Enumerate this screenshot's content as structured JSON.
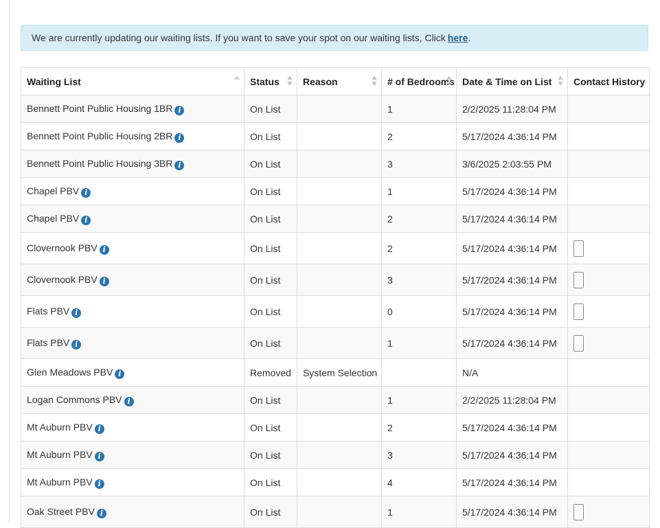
{
  "alert": {
    "message": "We are currently updating our waiting lists. If you want to save your spot on our waiting lists, Click",
    "link_text": "here",
    "trailing": "."
  },
  "table": {
    "headers": [
      "Waiting List",
      "Status",
      "Reason",
      "# of Bedrooms",
      "Date & Time on List",
      "Contact History"
    ],
    "rows": [
      {
        "name": "Bennett Point Public Housing 1BR",
        "status": "On List",
        "reason": "",
        "bedrooms": "1",
        "datetime": "2/2/2025 11:28:04 PM",
        "contact": false
      },
      {
        "name": "Bennett Point Public Housing 2BR",
        "status": "On List",
        "reason": "",
        "bedrooms": "2",
        "datetime": "5/17/2024 4:36:14 PM",
        "contact": false
      },
      {
        "name": "Bennett Point Public Housing 3BR",
        "status": "On List",
        "reason": "",
        "bedrooms": "3",
        "datetime": "3/6/2025 2:03:55 PM",
        "contact": false
      },
      {
        "name": "Chapel PBV",
        "status": "On List",
        "reason": "",
        "bedrooms": "1",
        "datetime": "5/17/2024 4:36:14 PM",
        "contact": false
      },
      {
        "name": "Chapel PBV",
        "status": "On List",
        "reason": "",
        "bedrooms": "2",
        "datetime": "5/17/2024 4:36:14 PM",
        "contact": false
      },
      {
        "name": "Clovernook PBV",
        "status": "On List",
        "reason": "",
        "bedrooms": "2",
        "datetime": "5/17/2024 4:36:14 PM",
        "contact": true
      },
      {
        "name": "Clovernook PBV",
        "status": "On List",
        "reason": "",
        "bedrooms": "3",
        "datetime": "5/17/2024 4:36:14 PM",
        "contact": true
      },
      {
        "name": "Flats PBV",
        "status": "On List",
        "reason": "",
        "bedrooms": "0",
        "datetime": "5/17/2024 4:36:14 PM",
        "contact": true
      },
      {
        "name": "Flats PBV",
        "status": "On List",
        "reason": "",
        "bedrooms": "1",
        "datetime": "5/17/2024 4:36:14 PM",
        "contact": true
      },
      {
        "name": "Glen Meadows PBV",
        "status": "Removed",
        "reason": "System Selection",
        "bedrooms": "",
        "datetime": "N/A",
        "contact": false
      },
      {
        "name": "Logan Commons PBV",
        "status": "On List",
        "reason": "",
        "bedrooms": "1",
        "datetime": "2/2/2025 11:28:04 PM",
        "contact": false
      },
      {
        "name": "Mt Auburn PBV",
        "status": "On List",
        "reason": "",
        "bedrooms": "2",
        "datetime": "5/17/2024 4:36:14 PM",
        "contact": false
      },
      {
        "name": "Mt Auburn PBV",
        "status": "On List",
        "reason": "",
        "bedrooms": "3",
        "datetime": "5/17/2024 4:36:14 PM",
        "contact": false
      },
      {
        "name": "Mt Auburn PBV",
        "status": "On List",
        "reason": "",
        "bedrooms": "4",
        "datetime": "5/17/2024 4:36:14 PM",
        "contact": false
      },
      {
        "name": "Oak Street PBV",
        "status": "On List",
        "reason": "",
        "bedrooms": "1",
        "datetime": "5/17/2024 4:36:14 PM",
        "contact": true
      }
    ]
  },
  "icons": {
    "info": "info-circle-icon",
    "info_glyph": "i",
    "accent": "#2a75b0",
    "alert_bg": "#d9edf7"
  }
}
